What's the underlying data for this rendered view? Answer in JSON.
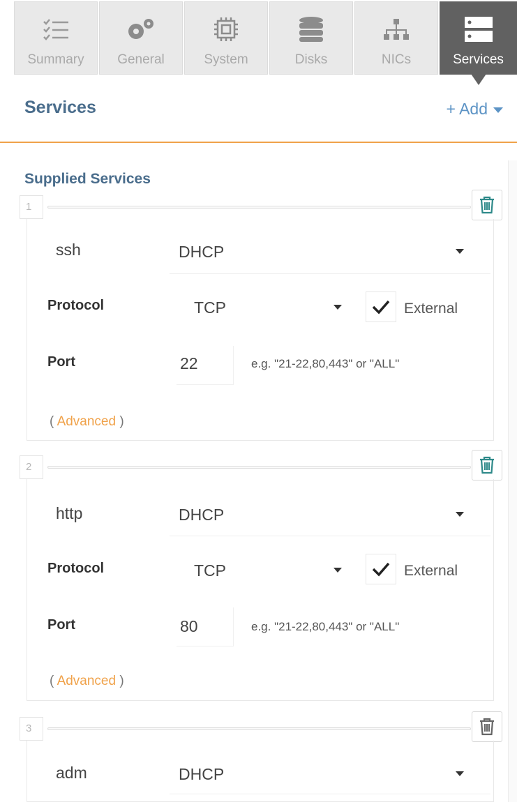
{
  "tabs": [
    {
      "label": "Summary",
      "icon": "list-icon",
      "active": false
    },
    {
      "label": "General",
      "icon": "gears-icon",
      "active": false
    },
    {
      "label": "System",
      "icon": "chip-icon",
      "active": false
    },
    {
      "label": "Disks",
      "icon": "database-icon",
      "active": false
    },
    {
      "label": "NICs",
      "icon": "network-icon",
      "active": false
    },
    {
      "label": "Services",
      "icon": "server-icon",
      "active": true
    }
  ],
  "header": {
    "title": "Services",
    "add_label": "+ Add"
  },
  "section": {
    "title": "Supplied Services"
  },
  "labels": {
    "protocol": "Protocol",
    "port": "Port",
    "external": "External",
    "port_hint": "e.g. \"21-22,80,443\" or \"ALL\"",
    "advanced_open": "(",
    "advanced_link": "Advanced",
    "advanced_close": ")"
  },
  "services": [
    {
      "index": "1",
      "name": "ssh",
      "mode": "DHCP",
      "protocol": "TCP",
      "external": true,
      "port": "22"
    },
    {
      "index": "2",
      "name": "http",
      "mode": "DHCP",
      "protocol": "TCP",
      "external": true,
      "port": "80"
    },
    {
      "index": "3",
      "name": "adm",
      "mode": "DHCP"
    }
  ],
  "colors": {
    "accent_blue": "#4a6d8c",
    "link_blue": "#5c93c5",
    "orange": "#f0a24a",
    "active_tab": "#616161"
  }
}
